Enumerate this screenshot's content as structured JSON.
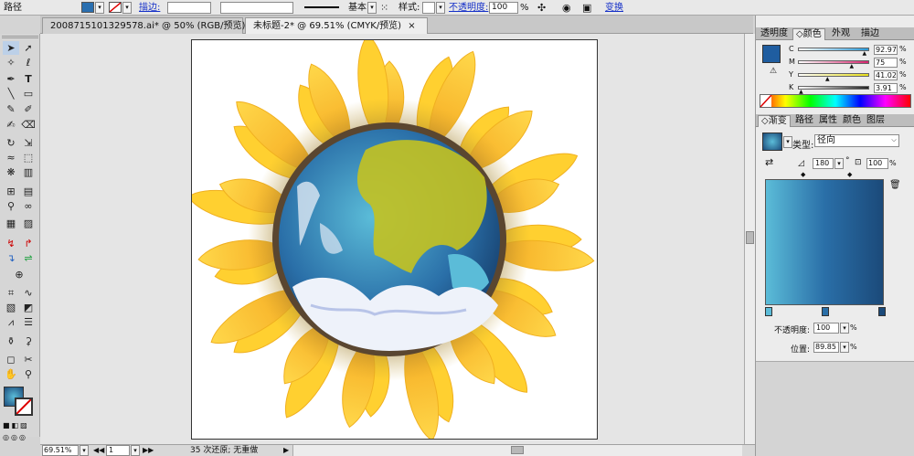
{
  "control_bar": {
    "object_type": "路径",
    "stroke_label": "描边:",
    "brush_label": "基本",
    "style_label": "样式:",
    "opacity_label": "不透明度:",
    "opacity_value": "100",
    "opacity_unit": "%",
    "transform_label": "变换"
  },
  "tabs": [
    {
      "label": "20087151013295​78.ai* @ 50% (RGB/预览)",
      "close": "×"
    },
    {
      "label": "未标题-2* @ 69.51% (CMYK/预览)",
      "close": "×"
    }
  ],
  "tool_icons": [
    "selection",
    "direct-selection",
    "magic-wand",
    "lasso",
    "pen",
    "type",
    "line",
    "rectangle",
    "paintbrush",
    "pencil",
    "blob-brush",
    "eraser",
    "rotate",
    "scale",
    "warp",
    "free-transform",
    "symbol-sprayer",
    "graph",
    "mesh",
    "gradient",
    "eyedropper",
    "blend",
    "live-paint",
    "live-paint-selection",
    "crop",
    "slice",
    "scissors",
    "hand",
    "zoom"
  ],
  "panel_color": {
    "tabs": [
      "透明度",
      "颜色",
      "外观",
      "描边"
    ],
    "active_tab": "颜色",
    "swatch_color": "#1f5da0",
    "channels": [
      {
        "name": "C",
        "value": "92.97",
        "unit": "%",
        "level": 0.93,
        "color": "#2a9ad8"
      },
      {
        "name": "M",
        "value": "75",
        "unit": "%",
        "level": 0.75,
        "color": "#d6246e"
      },
      {
        "name": "Y",
        "value": "41.02",
        "unit": "%",
        "level": 0.41,
        "color": "#e8df1a"
      },
      {
        "name": "K",
        "value": "3.91",
        "unit": "%",
        "level": 0.04,
        "color": "#222222"
      }
    ]
  },
  "panel_gradient": {
    "tabs": [
      "渐变",
      "路径",
      "属性",
      "颜色",
      "图层"
    ],
    "active_tab": "渐变",
    "type_label": "类型:",
    "type_value": "径向",
    "angle_value": "180",
    "degree": "°",
    "aspect_value": "100",
    "aspect_unit": "%",
    "stops": [
      "#5bbcd8",
      "#2a6fa8",
      "#1b4a7a"
    ],
    "opacity_label": "不透明度:",
    "opacity_value": "100",
    "opacity_unit": "%",
    "location_label": "位置:",
    "location_value": "89.85",
    "location_unit": "%"
  },
  "status_bar": {
    "zoom": "69.51%",
    "page": "1",
    "undo_info": "35 次还原; 无重做"
  }
}
